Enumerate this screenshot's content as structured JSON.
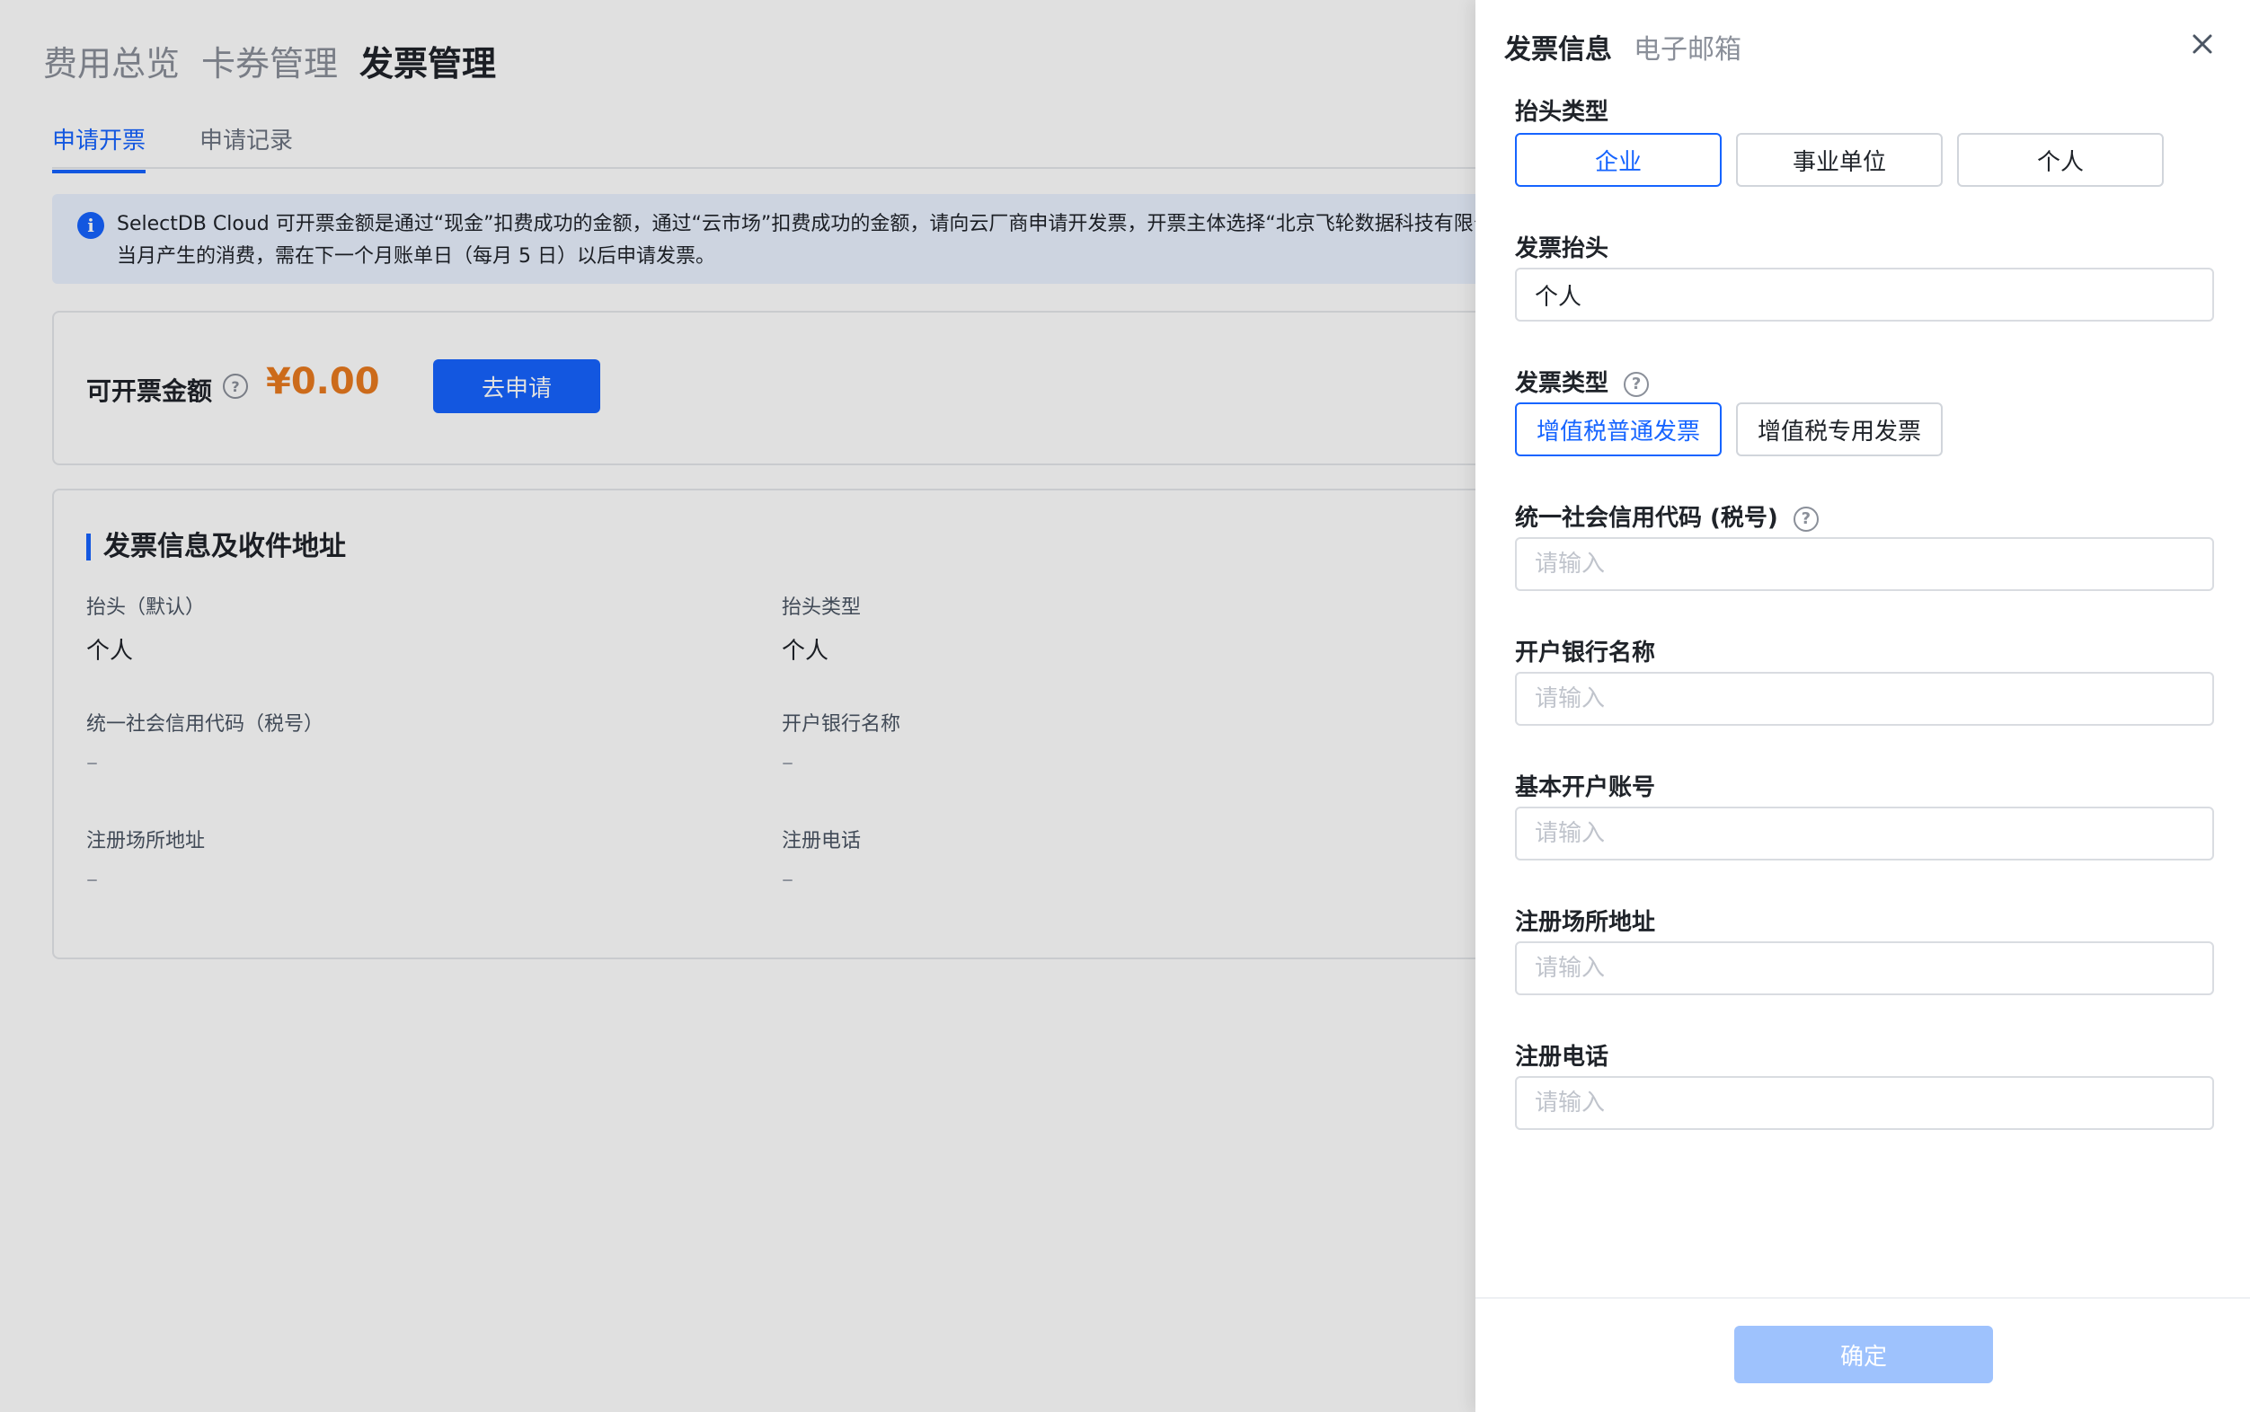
{
  "top_tabs": [
    "费用总览",
    "卡券管理",
    "发票管理"
  ],
  "sub_tabs": [
    "申请开票",
    "申请记录"
  ],
  "notice": {
    "line1": "SelectDB Cloud 可开票金额是通过“现金”扣费成功的金额，通过“云市场”扣费成功的金额，请向云厂商申请开发票，开票主体选择“北京飞轮数据科技有限公司",
    "line2": "当月产生的消费，需在下一个月账单日（每月 5 日）以后申请发票。"
  },
  "amount": {
    "label": "可开票金额",
    "value": "¥0.00",
    "apply_label": "去申请"
  },
  "info_card": {
    "title": "发票信息及收件地址",
    "items": [
      {
        "label": "抬头（默认）",
        "value": "个人"
      },
      {
        "label": "抬头类型",
        "value": "个人"
      },
      {
        "label": "统一社会信用代码（税号）",
        "value": "–"
      },
      {
        "label": "开户银行名称",
        "value": "–"
      },
      {
        "label": "注册场所地址",
        "value": "–"
      },
      {
        "label": "注册电话",
        "value": "–"
      }
    ]
  },
  "drawer": {
    "tabs": [
      "发票信息",
      "电子邮箱"
    ],
    "title_type": {
      "label": "抬头类型",
      "options": [
        "企业",
        "事业单位",
        "个人"
      ],
      "selected": "企业"
    },
    "invoice_title": {
      "label": "发票抬头",
      "value": "个人"
    },
    "invoice_type": {
      "label": "发票类型",
      "options": [
        "增值税普通发票",
        "增值税专用发票"
      ],
      "selected": "增值税普通发票"
    },
    "tax_id": {
      "label": "统一社会信用代码 (税号)",
      "placeholder": "请输入"
    },
    "bank_name": {
      "label": "开户银行名称",
      "placeholder": "请输入"
    },
    "account": {
      "label": "基本开户账号",
      "placeholder": "请输入"
    },
    "address": {
      "label": "注册场所地址",
      "placeholder": "请输入"
    },
    "phone": {
      "label": "注册电话",
      "placeholder": "请输入"
    },
    "confirm_label": "确定"
  }
}
